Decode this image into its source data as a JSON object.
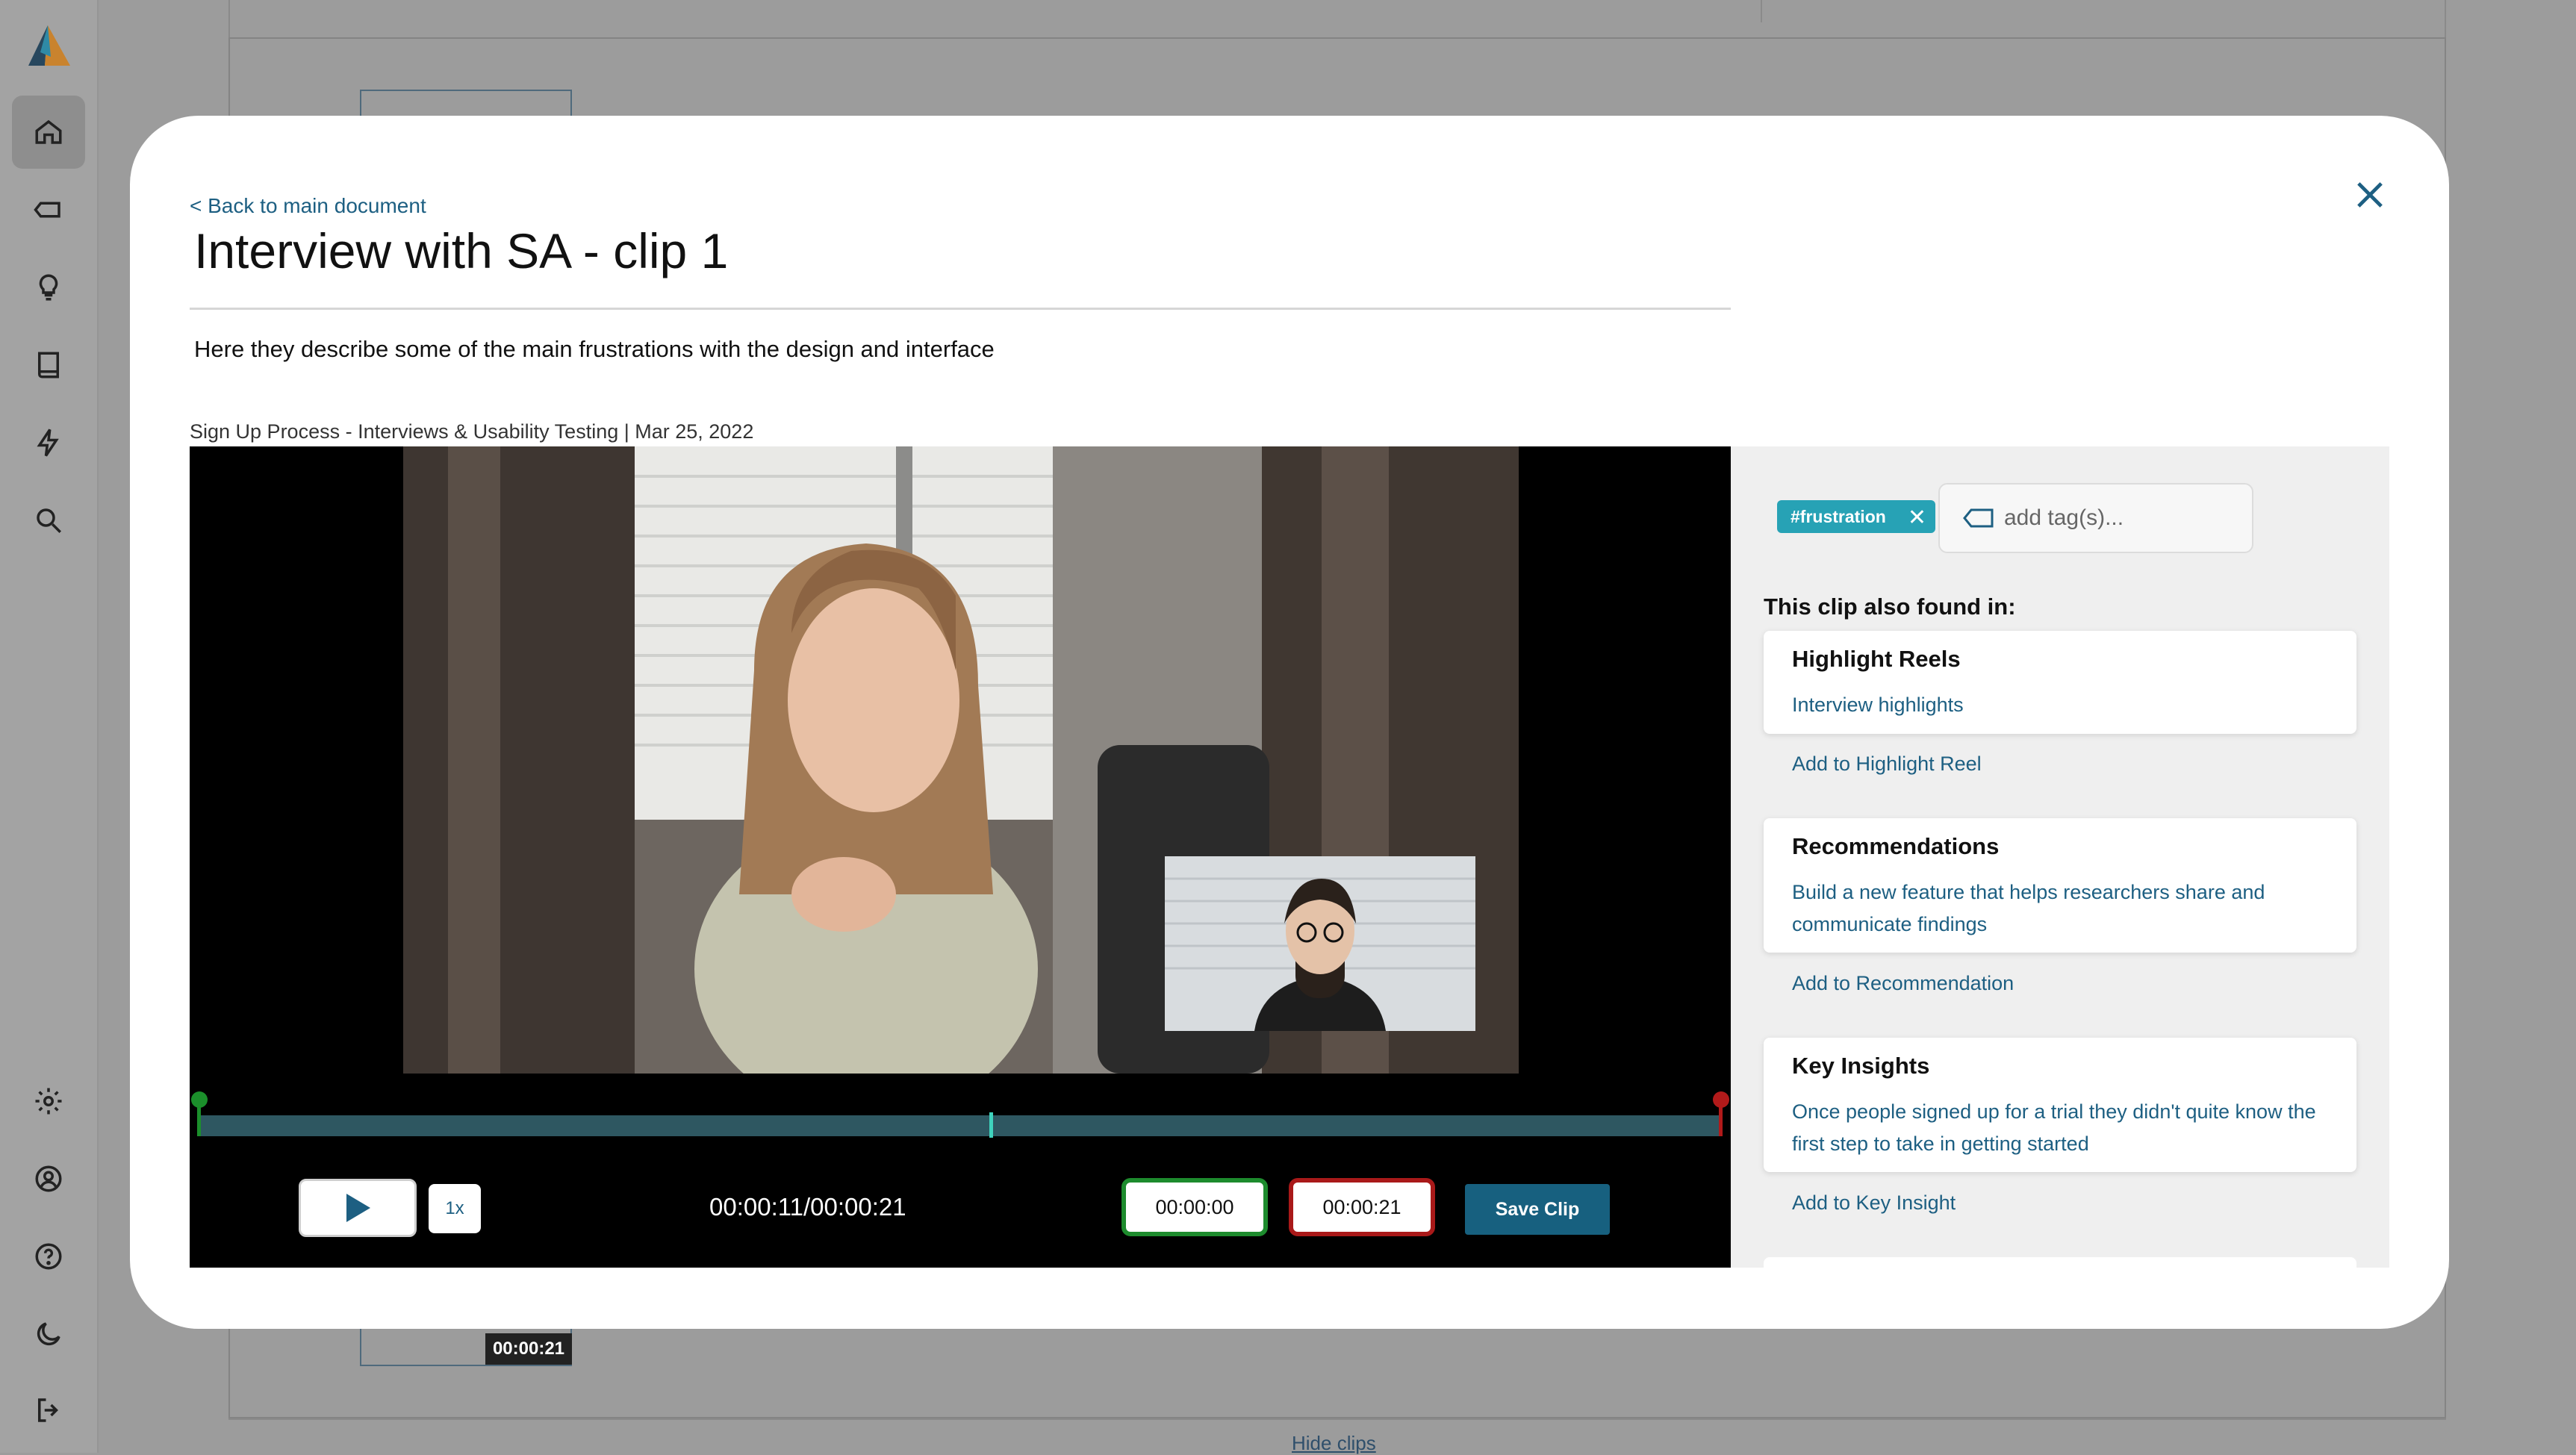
{
  "sidebar": {
    "items": [
      {
        "icon": "home-icon",
        "active": true
      },
      {
        "icon": "tag-icon"
      },
      {
        "icon": "lightbulb-icon"
      },
      {
        "icon": "book-icon"
      },
      {
        "icon": "bolt-icon"
      },
      {
        "icon": "search-icon"
      }
    ],
    "bottom_items": [
      {
        "icon": "gear-icon"
      },
      {
        "icon": "user-circle-icon"
      },
      {
        "icon": "help-icon"
      },
      {
        "icon": "moon-icon"
      },
      {
        "icon": "logout-icon"
      }
    ]
  },
  "background": {
    "clip_time": "00:00:21",
    "hide_clips": "Hide clips"
  },
  "modal": {
    "back_link": "< Back to main document",
    "title": "Interview with SA - clip 1",
    "description": "Here they describe some of the main frustrations with the design and interface",
    "meta": "Sign Up Process - Interviews & Usability Testing | Mar 25, 2022"
  },
  "player": {
    "speed": "1x",
    "timecode": "00:00:11/00:00:21",
    "start_time": "00:00:00",
    "end_time": "00:00:21",
    "save_label": "Save Clip",
    "progress": 0.52
  },
  "panel": {
    "tag": "#frustration",
    "tag_placeholder": "add tag(s)...",
    "found_label": "This clip also found in:",
    "highlight_title": "Highlight Reels",
    "highlight_item": "Interview highlights",
    "highlight_add": "Add to Highlight Reel",
    "recommend_title": "Recommendations",
    "recommend_item": "Build a new feature that helps researchers share and communicate findings",
    "recommend_add": "Add to Recommendation",
    "insight_title": "Key Insights",
    "insight_item": "Once people signed up for a trial they didn't quite know the first step to take in getting started",
    "insight_add": "Add to Key Insight"
  },
  "colors": {
    "accent": "#1d5f82",
    "tag": "#27a2b5",
    "start_marker": "#1b8f2b",
    "end_marker": "#b21a1a"
  }
}
